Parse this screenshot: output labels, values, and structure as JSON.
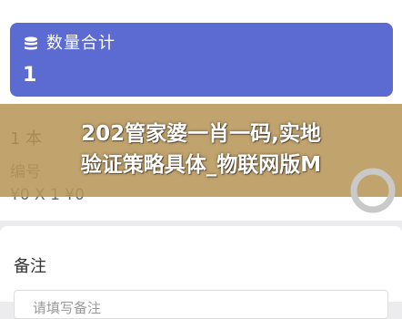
{
  "summary": {
    "icon": "database-stack-icon",
    "label": "数量合计",
    "value": "1"
  },
  "item": {
    "line1": "1  本",
    "line2": "编号",
    "line3": "¥0 X 1  ¥0"
  },
  "overlay": {
    "line1": "202管家婆一肖一码,实地",
    "line2": "验证策略具体_物联网版M"
  },
  "notes": {
    "label": "备注",
    "placeholder": "请填写备注"
  },
  "colors": {
    "summary_panel": "#5c6bd1",
    "overlay_band": "#b8965a"
  }
}
